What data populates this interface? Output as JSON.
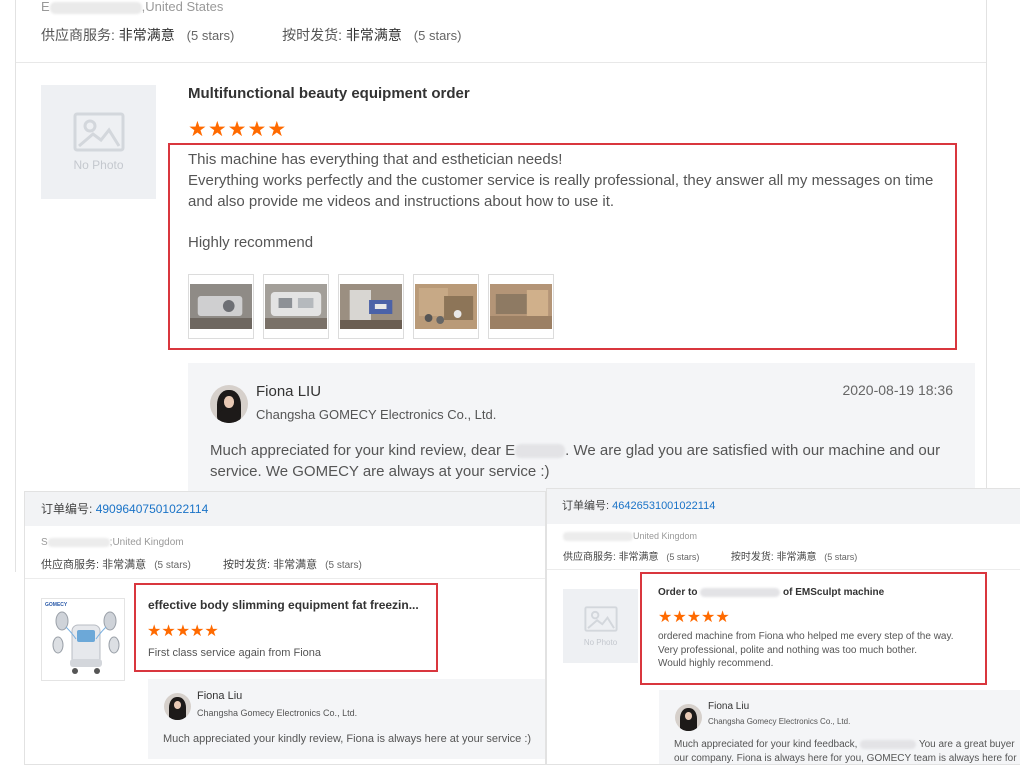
{
  "top_panel": {
    "location_prefix": "E",
    "location_suffix": ",United States",
    "supplier_service_label": "供应商服务:",
    "supplier_service_value": "非常满意",
    "supplier_service_stars": "(5 stars)",
    "ontime_label": "按时发货:",
    "ontime_value": "非常满意",
    "ontime_stars": "(5 stars)",
    "no_photo_text": "No Photo",
    "product_title": "Multifunctional beauty equipment order",
    "rating": 5,
    "review_lines": [
      "This machine has everything that and esthetician needs!",
      "Everything works perfectly and the customer service is really professional, they answer all my messages on time and also provide me videos and instructions about how to use it.",
      "Highly recommend"
    ],
    "photo_count": 5,
    "reply": {
      "name": "Fiona LIU",
      "company": "Changsha GOMECY Electronics Co., Ltd.",
      "date": "2020-08-19 18:36",
      "text_before_redaction": "Much appreciated for your kind review, dear E",
      "text_after_redaction": ". We are glad you are satisfied with our machine and our service. We GOMECY are always at your service :)"
    }
  },
  "bottom_left": {
    "order_label": "订单编号:",
    "order_number": "49096407501022114",
    "location_prefix": "S",
    "location_suffix": ";United Kingdom",
    "supplier_service_label": "供应商服务:",
    "supplier_service_value": "非常满意",
    "supplier_service_stars": "(5 stars)",
    "ontime_label": "按时发货:",
    "ontime_value": "非常满意",
    "ontime_stars": "(5 stars)",
    "product_brand": "GOMECY",
    "product_title": "effective body slimming equipment fat freezin...",
    "rating": 5,
    "review_text": "First class service again from Fiona",
    "reply": {
      "name": "Fiona Liu",
      "company": "Changsha Gomecy Electronics Co., Ltd.",
      "text": "Much appreciated your kindly review, Fiona is always here at your service :)"
    }
  },
  "bottom_right": {
    "order_label": "订单编号:",
    "order_number": "46426531001022114",
    "location_suffix": "United Kingdom",
    "supplier_service_label": "供应商服务:",
    "supplier_service_value": "非常满意",
    "supplier_service_stars": "(5 stars)",
    "ontime_label": "按时发货:",
    "ontime_value": "非常满意",
    "ontime_stars": "(5 stars)",
    "no_photo_text": "No Photo",
    "product_title_prefix": "Order to",
    "product_title_suffix": "of EMSculpt machine",
    "rating": 5,
    "review_lines": [
      "ordered machine from Fiona who helped me every step of the way.",
      "Very professional, polite and nothing was too much bother.",
      "Would highly recommend."
    ],
    "reply": {
      "name": "Fiona Liu",
      "company": "Changsha Gomecy Electronics Co., Ltd.",
      "line1_before_redaction": "Much appreciated for your kind feedback,",
      "line1_after_redaction": "You are a great buyer",
      "line2": "our company. Fiona is always here for you, GOMECY team is always here for"
    }
  },
  "colors": {
    "star": "#ff6a00",
    "highlight_box": "#d9363e",
    "order_link": "#1a73c7",
    "reply_bg": "#f4f5f7"
  }
}
